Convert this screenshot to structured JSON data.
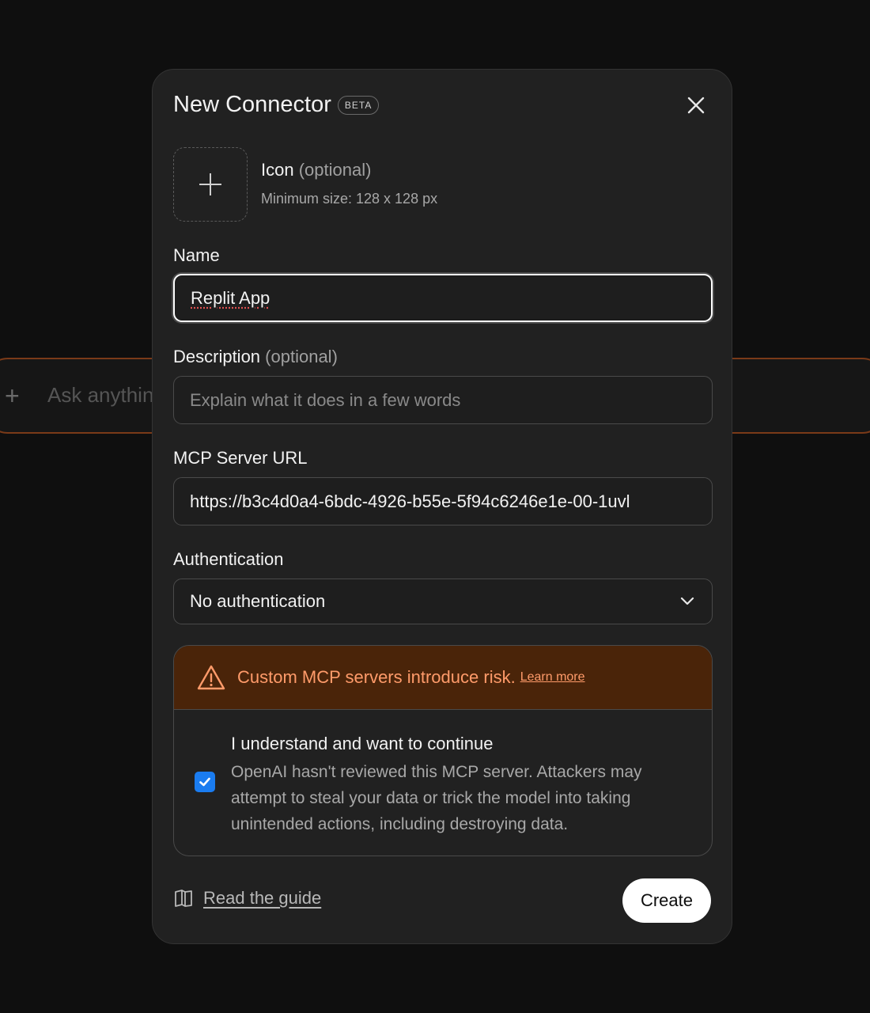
{
  "background": {
    "composer_placeholder": "Ask anythin"
  },
  "modal": {
    "title": "New Connector",
    "badge": "BETA",
    "icon_upload": {
      "label": "Icon",
      "optional": "(optional)",
      "hint": "Minimum size: 128 x 128 px"
    },
    "name_field": {
      "label": "Name",
      "value": "Replit App"
    },
    "description_field": {
      "label": "Description",
      "optional": "(optional)",
      "placeholder": "Explain what it does in a few words"
    },
    "url_field": {
      "label": "MCP Server URL",
      "value": "https://b3c4d0a4-6bdc-4926-b55e-5f94c6246e1e-00-1uvl"
    },
    "auth_field": {
      "label": "Authentication",
      "selected": "No authentication"
    },
    "warning": {
      "text": "Custom MCP servers introduce risk.",
      "link": "Learn more",
      "color": "#ff9b6a",
      "background": "#4a2409"
    },
    "acknowledge": {
      "checked": true,
      "title": "I understand and want to continue",
      "description": "OpenAI hasn't reviewed this MCP server. Attackers may attempt to steal your data or trick the model into taking unintended actions, including destroying data."
    },
    "footer": {
      "guide_link": "Read the guide",
      "create_button": "Create"
    }
  },
  "colors": {
    "accent_checkbox": "#1a7cf0",
    "composer_border": "#7a3a18"
  }
}
